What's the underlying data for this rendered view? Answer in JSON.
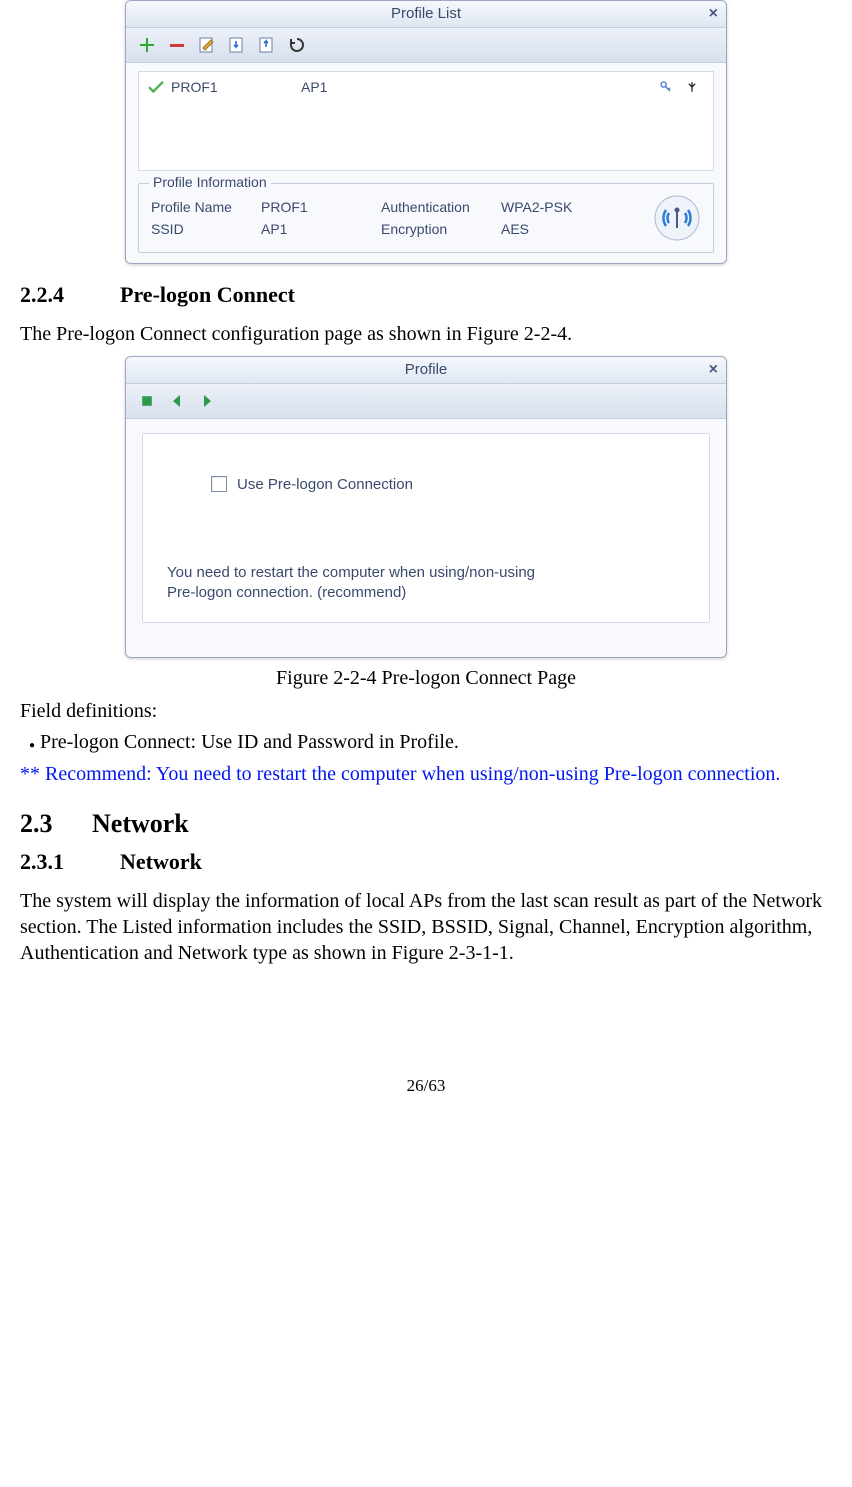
{
  "win1": {
    "title": "Profile List",
    "row": {
      "profile": "PROF1",
      "ssid": "AP1"
    },
    "info": {
      "legend": "Profile Information",
      "pn_label": "Profile Name",
      "pn_value": "PROF1",
      "ssid_label": "SSID",
      "ssid_value": "AP1",
      "auth_label": "Authentication",
      "auth_value": "WPA2-PSK",
      "enc_label": "Encryption",
      "enc_value": "AES"
    }
  },
  "doc": {
    "sec224_num": "2.2.4",
    "sec224_title": "Pre-logon Connect",
    "intro224": "The Pre-logon Connect configuration page as shown in Figure 2-2-4.",
    "caption224": "Figure 2-2-4 Pre-logon Connect Page",
    "field_defs": "Field definitions:",
    "bullet1": "Pre-logon Connect: Use ID and Password in Profile.",
    "note": "** Recommend: You need to restart the computer when using/non-using Pre-logon connection.",
    "sec23_num": "2.3",
    "sec23_title": "Network",
    "sec231_num": "2.3.1",
    "sec231_title": "Network",
    "para231": "The system will display the information of local APs from the last scan result as part of the Network section. The Listed information includes the SSID, BSSID, Signal, Channel, Encryption algorithm, Authentication and Network type as shown in Figure 2-3-1-1.",
    "page": "26/63"
  },
  "win2": {
    "title": "Profile",
    "checkbox_label": "Use Pre-logon Connection",
    "msg_line1": "You need to restart the computer when using/non-using",
    "msg_line2": "Pre-logon connection. (recommend)"
  }
}
